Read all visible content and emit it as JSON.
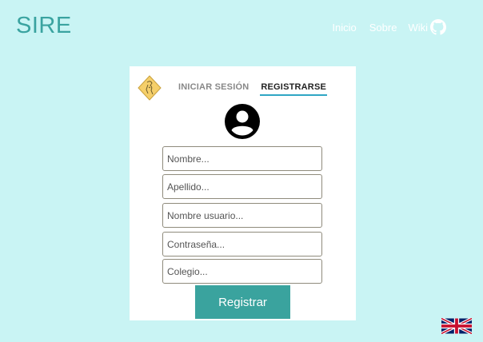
{
  "brand": "SIRE",
  "nav": {
    "home": "Inicio",
    "about": "Sobre",
    "wiki": "Wiki",
    "github_icon": "github-icon"
  },
  "tabs": {
    "login": "INICIAR SESIÓN",
    "register": "REGISTRARSE"
  },
  "form": {
    "first_name_placeholder": "Nombre...",
    "last_name_placeholder": "Apellido...",
    "username_placeholder": "Nombre usuario...",
    "password_placeholder": "Contraseña...",
    "school_placeholder": "Colegio...",
    "submit_label": "Registrar"
  },
  "icons": {
    "logo": "lion-logo-icon",
    "avatar": "user-avatar-icon",
    "language": "uk-flag-icon"
  },
  "colors": {
    "background": "#c9f4f4",
    "brand": "#3aa3a0",
    "button": "#3aa39e",
    "tab_underline": "#2fa6c4"
  }
}
